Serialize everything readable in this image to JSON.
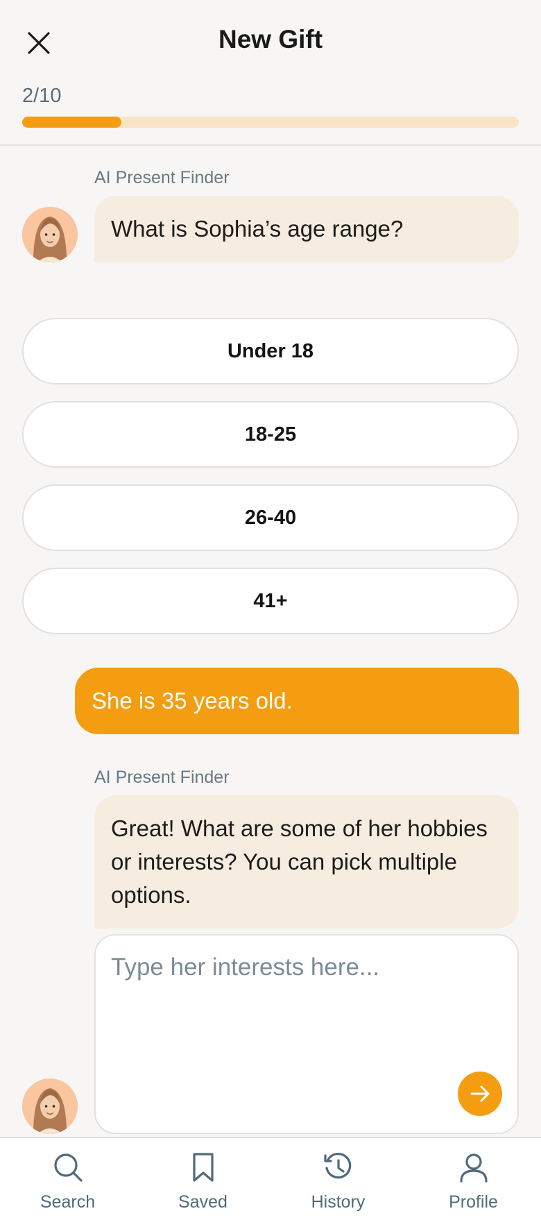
{
  "header": {
    "title": "New Gift",
    "progress": {
      "label": "2/10",
      "fraction": 0.2
    }
  },
  "chat": {
    "sender_name": "AI Present Finder",
    "question1": "What is Sophia’s age range?",
    "options": [
      "Under 18",
      "18-25",
      "26-40",
      "41+"
    ],
    "user_reply": "She is 35 years old.",
    "question2": "Great! What are some of her hobbies or interests? You can pick multiple options.",
    "input": {
      "placeholder": "Type her interests here...",
      "value": ""
    }
  },
  "nav": {
    "items": [
      {
        "label": "Search",
        "icon": "search-icon"
      },
      {
        "label": "Saved",
        "icon": "bookmark-icon"
      },
      {
        "label": "History",
        "icon": "history-icon"
      },
      {
        "label": "Profile",
        "icon": "profile-icon"
      }
    ]
  },
  "colors": {
    "accent": "#f49d10",
    "progress_track": "#f8e4c6",
    "ai_bubble": "#f6ece0",
    "background": "#f7f6f4"
  }
}
